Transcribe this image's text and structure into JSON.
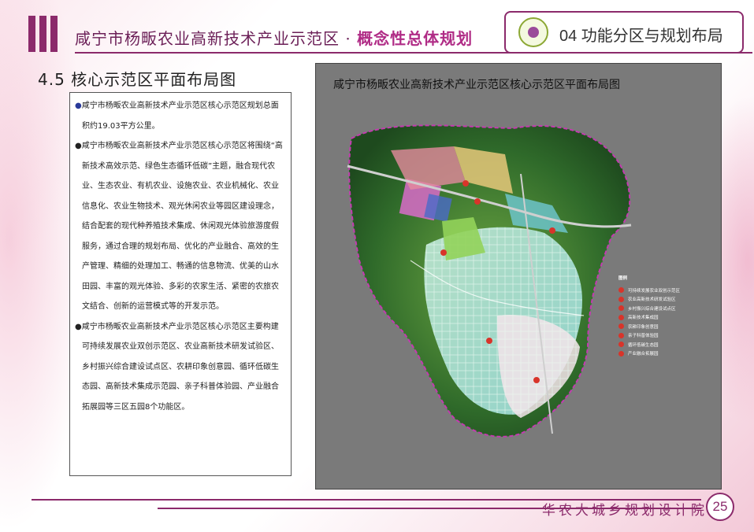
{
  "header": {
    "title": "咸宁市杨畈农业高新技术产业示范区 · ",
    "subtitle": "概念性总体规划"
  },
  "badge": {
    "label": "04 功能分区与规划布局",
    "icon": "flower-logo-icon"
  },
  "section": {
    "title": "4.5 核心示范区平面布局图"
  },
  "body": {
    "paragraphs": [
      {
        "bullet": "●",
        "text": "咸宁市杨畈农业高新技术产业示范区核心示范区规划总面积约19.03平方公里。"
      },
      {
        "bullet": "●",
        "text": "咸宁市杨畈农业高新技术产业示范区核心示范区将围绕“高新技术高效示范、绿色生态循环低碳”主题，融合现代农业、生态农业、有机农业、设施农业、农业机械化、农业信息化、农业生物技术、观光休闲农业等园区建设理念，结合配套的现代种养殖技术集成、休闲观光体验旅游度假服务，通过合理的规划布局、优化的产业融合、高效的生产管理、精细的处理加工、畅通的信息物流、优美的山水田园、丰富的观光体验、多彩的农家生活、紧密的农旅农文结合、创新的运营模式等的开发示范。"
      },
      {
        "bullet": "●",
        "text": "咸宁市杨畈农业高新技术产业示范区核心示范区主要构建可持续发展农业双创示范区、农业高新技术研发试验区、乡村振兴综合建设试点区、农耕印象创意园、循环低碳生态园、高新技术集成示范园、亲子科普体验园、产业融合拓展园等三区五园8个功能区。"
      }
    ]
  },
  "map": {
    "title": "咸宁市杨畈农业高新技术产业示范区核心示范区平面布局图",
    "legend_title": "图例",
    "legend_items": [
      "可持续发展农业双创示范区",
      "农业高新技术研发试验区",
      "乡村振兴综合建设试点区",
      "高新技术集成园",
      "农耕印象创意园",
      "亲子科普体验园",
      "循环低碳生态园",
      "产业融合拓展园"
    ],
    "marker_color": "#d8342a"
  },
  "footer": {
    "institute": "华农大城乡规划设计院",
    "page": "25"
  },
  "colors": {
    "brand": "#8b2a6b",
    "accent": "#b02c86"
  }
}
